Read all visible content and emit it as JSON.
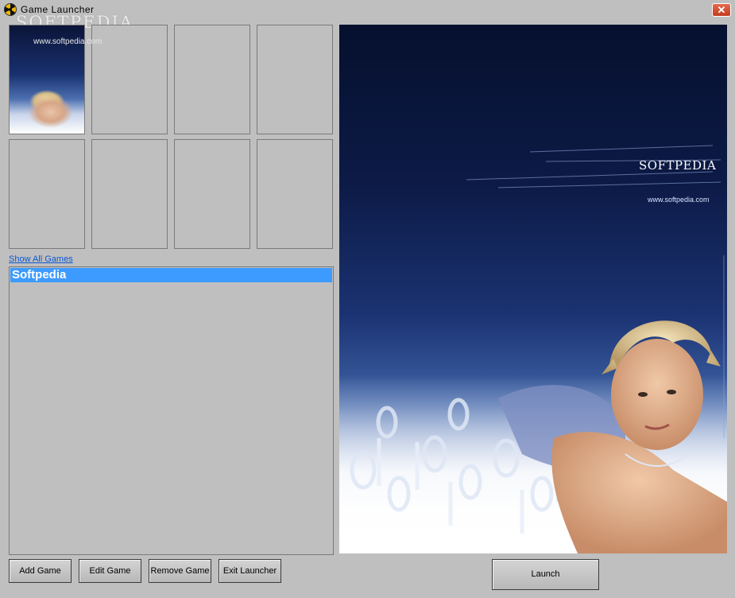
{
  "window": {
    "title": "Game  Launcher",
    "close_glyph": "✕",
    "icon": "app-icon",
    "watermark": "SOFTPEDIA",
    "watermark_sub": "www.softpedia.com"
  },
  "sidebar": {
    "show_all_link": "Show All Games",
    "game_list": {
      "items": [
        {
          "label": "Softpedia",
          "selected": true
        }
      ]
    }
  },
  "buttons": {
    "add_game": "Add Game",
    "edit_game": "Edit Game",
    "remove_game": "Remove Game",
    "exit_launcher": "Exit Launcher",
    "launch": "Launch"
  },
  "preview": {
    "brand": "SOFTPEDIA",
    "tm": "™",
    "url": "www.softpedia.com"
  },
  "colors": {
    "window_bg": "#bfbfbf",
    "selection": "#3d9bff",
    "link": "#0a57d6",
    "close_button": "#d0492b"
  }
}
